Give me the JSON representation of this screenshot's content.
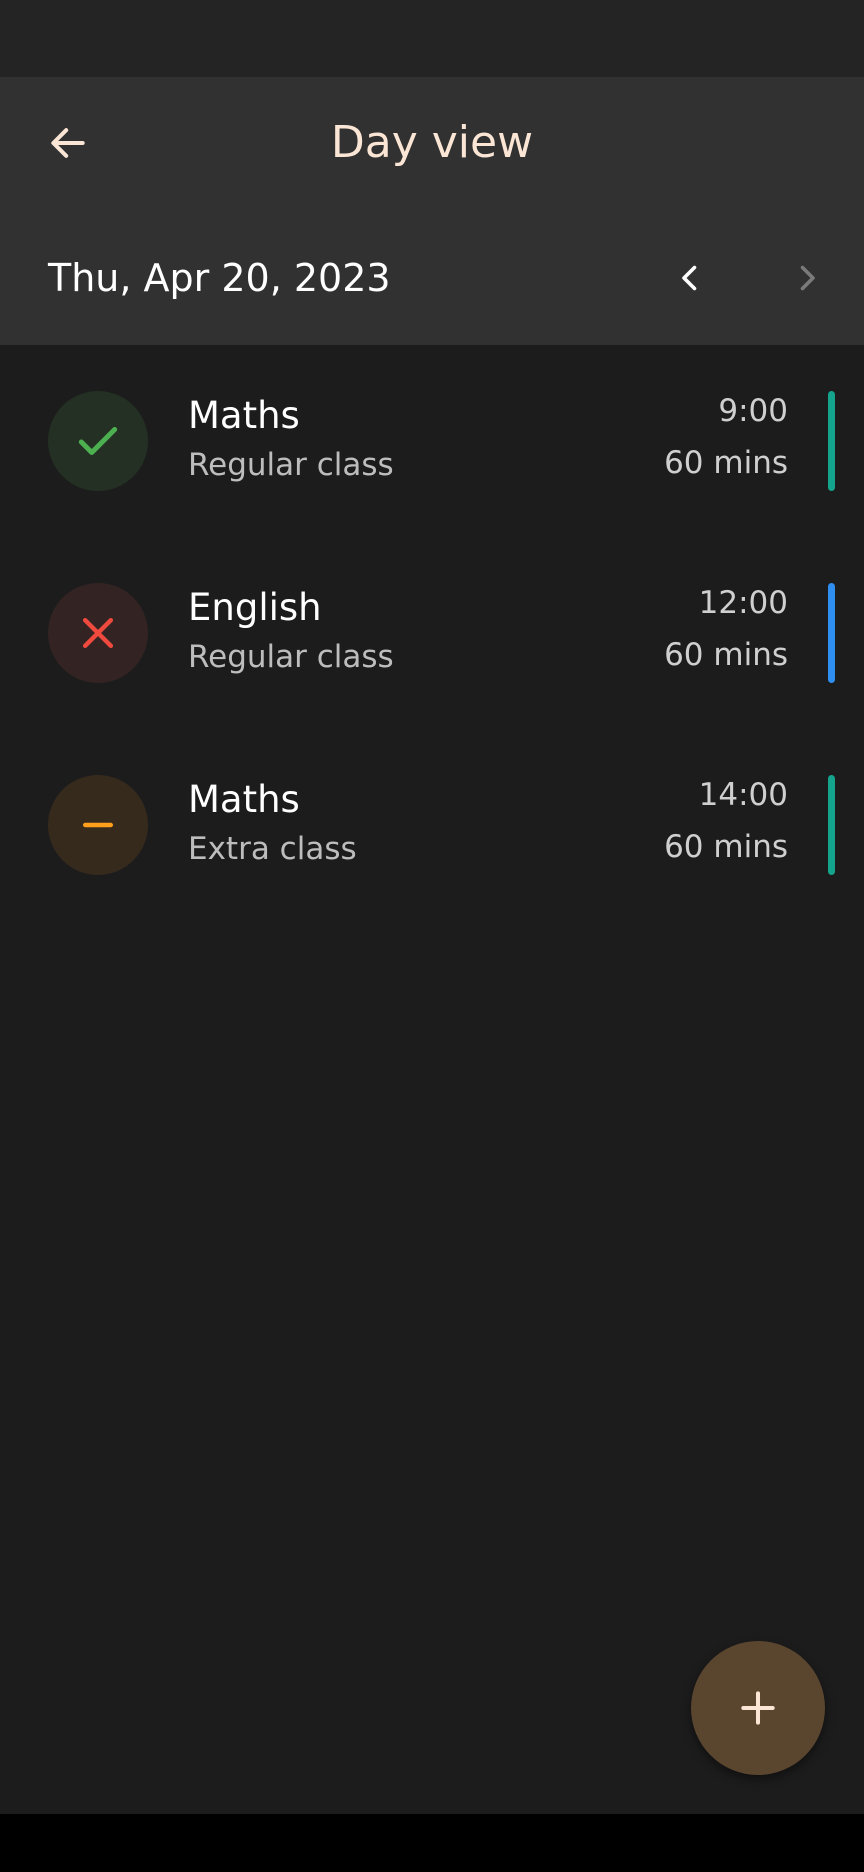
{
  "header": {
    "title": "Day view",
    "back_icon": "arrow-left-icon",
    "title_color": "#fbe6d6"
  },
  "date_nav": {
    "date": "Thu, Apr 20, 2023",
    "prev_icon": "chevron-left-icon",
    "next_icon": "chevron-right-icon",
    "next_enabled": false
  },
  "classes": [
    {
      "subject": "Maths",
      "type": "Regular class",
      "time": "9:00",
      "duration": "60 mins",
      "status": "attended",
      "status_icon": "check-icon",
      "status_color": "#4caf50",
      "circle_bg": "#243024",
      "accent_color": "#14a38c"
    },
    {
      "subject": "English",
      "type": "Regular class",
      "time": "12:00",
      "duration": "60 mins",
      "status": "missed",
      "status_icon": "close-icon",
      "status_color": "#f04a3e",
      "circle_bg": "#332423",
      "accent_color": "#2f8ff0"
    },
    {
      "subject": "Maths",
      "type": "Extra class",
      "time": "14:00",
      "duration": "60 mins",
      "status": "pending",
      "status_icon": "minus-icon",
      "status_color": "#ff9f1c",
      "circle_bg": "#362a1d",
      "accent_color": "#14a38c"
    }
  ],
  "fab": {
    "icon": "plus-icon",
    "background": "#5a452f",
    "icon_color": "#fbe6d6"
  }
}
